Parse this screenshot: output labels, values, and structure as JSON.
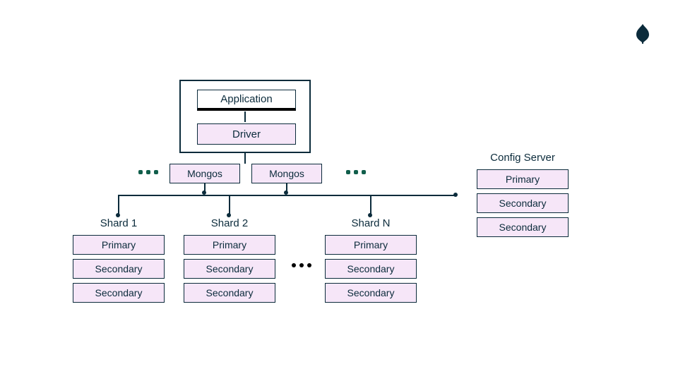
{
  "logo": {
    "name": "mongodb-leaf",
    "fill": "#0b2b3b"
  },
  "app_frame": {
    "application_label": "Application",
    "driver_label": "Driver"
  },
  "mongos_row": {
    "mongos1_label": "Mongos",
    "mongos2_label": "Mongos",
    "ellipsis_left": "•••",
    "ellipsis_right": "•••"
  },
  "shards": {
    "shard1": {
      "title": "Shard 1",
      "primary": "Primary",
      "secondary1": "Secondary",
      "secondary2": "Secondary"
    },
    "shard2": {
      "title": "Shard 2",
      "primary": "Primary",
      "secondary1": "Secondary",
      "secondary2": "Secondary"
    },
    "shardN": {
      "title": "Shard N",
      "primary": "Primary",
      "secondary1": "Secondary",
      "secondary2": "Secondary"
    },
    "ellipsis": "•••"
  },
  "config_server": {
    "title": "Config Server",
    "primary": "Primary",
    "secondary1": "Secondary",
    "secondary2": "Secondary"
  }
}
